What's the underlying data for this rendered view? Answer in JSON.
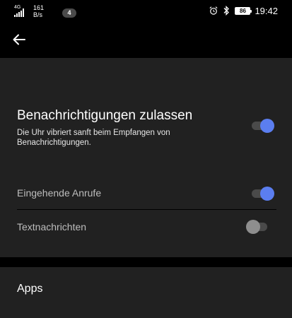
{
  "status_bar": {
    "network_type": "4G",
    "speed_value": "161",
    "speed_unit": "B/s",
    "notification_count": "4",
    "battery": "86",
    "time": "19:42"
  },
  "main": {
    "title": "Benachrichtigungen zulassen",
    "description": "Die Uhr vibriert sanft beim Empfangen von Benachrichtigungen.",
    "enabled": true
  },
  "options": [
    {
      "label": "Eingehende Anrufe",
      "enabled": true
    },
    {
      "label": "Textnachrichten",
      "enabled": false
    }
  ],
  "apps_section": {
    "title": "Apps"
  },
  "colors": {
    "accent": "#5b7ef0",
    "card": "#212121",
    "background": "#000000"
  }
}
